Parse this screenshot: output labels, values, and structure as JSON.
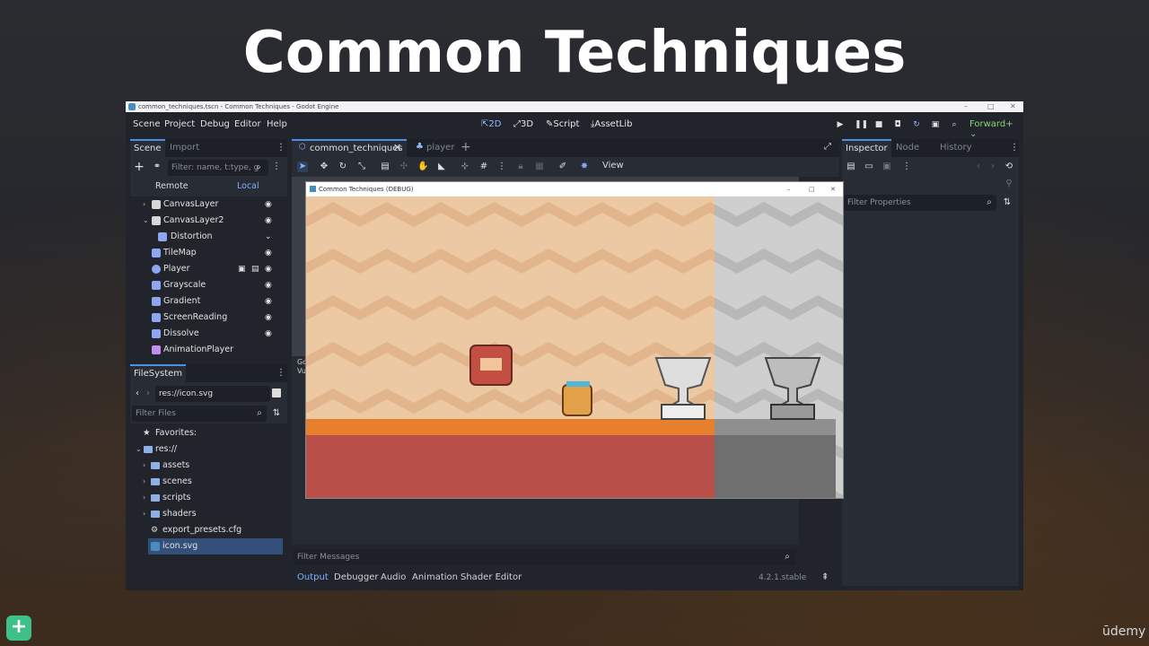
{
  "slide": {
    "title": "Common Techniques"
  },
  "window": {
    "title": "common_techniques.tscn - Common Techniques - Godot Engine"
  },
  "menu": {
    "items": [
      "Scene",
      "Project",
      "Debug",
      "Editor",
      "Help"
    ]
  },
  "workspaces": {
    "2d": "2D",
    "3d": "3D",
    "script": "Script",
    "assetlib": "AssetLib"
  },
  "renderer": "Forward+",
  "scene_dock": {
    "tabs": [
      "Scene",
      "Import"
    ],
    "filter_placeholder": "Filter: name, t:type, g",
    "remote": "Remote",
    "local": "Local",
    "nodes": [
      {
        "label": "CanvasLayer",
        "icon": "canvas-layer-icon"
      },
      {
        "label": "CanvasLayer2",
        "icon": "canvas-layer-icon"
      },
      {
        "label": "Distortion",
        "icon": "node-icon"
      },
      {
        "label": "TileMap",
        "icon": "tilemap-icon"
      },
      {
        "label": "Player",
        "icon": "character-icon"
      },
      {
        "label": "Grayscale",
        "icon": "node-icon"
      },
      {
        "label": "Gradient",
        "icon": "node-icon"
      },
      {
        "label": "ScreenReading",
        "icon": "node-icon"
      },
      {
        "label": "Dissolve",
        "icon": "node-icon"
      },
      {
        "label": "AnimationPlayer",
        "icon": "animation-icon"
      }
    ]
  },
  "filesystem": {
    "tab": "FileSystem",
    "path": "res://icon.svg",
    "filter_placeholder": "Filter Files",
    "favorites": "Favorites:",
    "root": "res://",
    "items": [
      "assets",
      "scenes",
      "scripts",
      "shaders",
      "export_presets.cfg",
      "icon.svg"
    ]
  },
  "editor_tabs": [
    "common_techniques",
    "player"
  ],
  "toolbar": {
    "view": "View"
  },
  "output": {
    "filter_placeholder": "Filter Messages",
    "tabs": [
      "Output",
      "Debugger",
      "Audio",
      "Animation",
      "Shader Editor"
    ],
    "version": "4.2.1.stable",
    "log_start": "Go",
    "log_start2": "Vu"
  },
  "game_window": {
    "title": "Common Techniques (DEBUG)"
  },
  "inspector": {
    "tabs": [
      "Inspector",
      "Node",
      "History"
    ],
    "filter_placeholder": "Filter Properties"
  },
  "branding": {
    "udemy": "ūdemy"
  },
  "colors": {
    "accent": "#4a90e8",
    "renderer": "#8bd37a",
    "panel": "#282c34",
    "bg": "#21252b"
  }
}
